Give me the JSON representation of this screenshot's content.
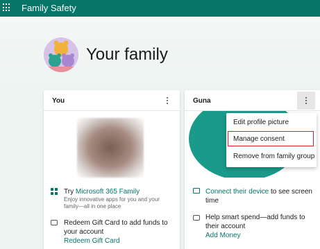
{
  "header": {
    "app_title": "Family Safety",
    "icon": "app-launcher-icon",
    "color": "#077568"
  },
  "page": {
    "title": "Your family"
  },
  "cards": [
    {
      "name": "You",
      "rows": [
        {
          "prefix": "Try ",
          "link": "Microsoft 365 Family",
          "sub": "Enjoy innovative apps for you and your family—all in one place",
          "icon": "microsoft-365-icon"
        },
        {
          "text": "Redeem Gift Card to add funds to your account",
          "link": "Redeem Gift Card",
          "icon": "gift-card-icon"
        }
      ]
    },
    {
      "name": "Guna",
      "rows": [
        {
          "link": "Connect their device",
          "suffix": " to see screen time",
          "icon": "device-icon"
        },
        {
          "text": "Help smart spend—add funds to their account",
          "link": "Add Money",
          "icon": "money-icon"
        }
      ]
    }
  ],
  "context_menu": {
    "items": [
      "Edit profile picture",
      "Manage consent",
      "Remove from family group"
    ],
    "highlighted": "Manage consent"
  },
  "colors": {
    "accent": "#077568",
    "highlight_border": "#e02020"
  }
}
